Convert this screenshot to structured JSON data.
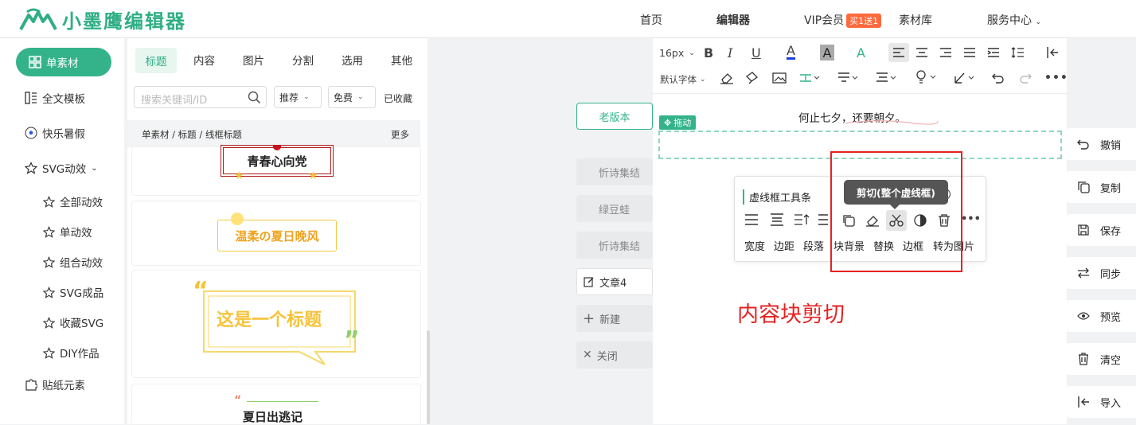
{
  "app": {
    "logo_text": "小墨鹰编辑器"
  },
  "nav": {
    "home": "首页",
    "editor": "编辑器",
    "vip": "VIP会员",
    "vip_badge": "买1送1",
    "library": "素材库",
    "service": "服务中心"
  },
  "sidebar": {
    "active": "单素材",
    "items": [
      "全文模板",
      "快乐暑假",
      "SVG动效",
      "全部动效",
      "单动效",
      "组合动效",
      "SVG成品",
      "收藏SVG",
      "DIY作品",
      "贴纸元素"
    ]
  },
  "panel": {
    "tabs": [
      "标题",
      "内容",
      "图片",
      "分割",
      "选用",
      "其他"
    ],
    "search_placeholder": "搜索关键词/ID",
    "sort_value": "推荐",
    "price_value": "免费",
    "favorites": "已收藏",
    "breadcrumb": "单素材 / 标题 / 线框标题",
    "more": "更多",
    "cards": [
      "青春心向党",
      "温柔の夏日晚风",
      "这是一个标题",
      "夏日出逃记"
    ]
  },
  "articles": {
    "old_version": "老版本",
    "items": [
      "忻诗集结",
      "绿豆蛙",
      "忻诗集结"
    ],
    "current": "文章4",
    "new": "新建",
    "close": "关闭"
  },
  "toolbar": {
    "font_size": "16px",
    "font_family": "默认字体"
  },
  "document": {
    "drag_tag": "拖动",
    "sample_text": "何止七夕，还要朝夕。"
  },
  "float_toolbar": {
    "title": "虚线框工具条",
    "labels": [
      "宽度",
      "边距",
      "段落",
      "块背景",
      "替换",
      "边框",
      "转为图片"
    ],
    "tooltip": "剪切(整个虚线框)"
  },
  "caption": "内容块剪切",
  "right_actions": [
    "撤销",
    "复制",
    "保存",
    "同步",
    "预览",
    "清空",
    "导入"
  ],
  "colors": {
    "brand": "#34b38a",
    "annotation": "#e52222"
  }
}
